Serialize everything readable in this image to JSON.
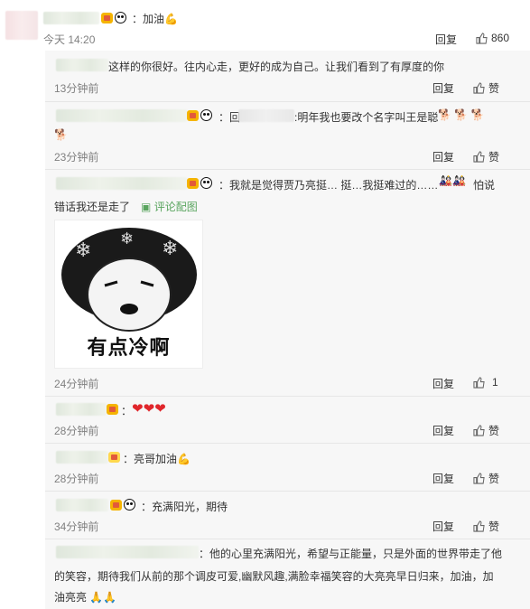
{
  "top_comment": {
    "time": "今天 14:20",
    "text": "：加油",
    "reply_label": "回复",
    "like_count": "860"
  },
  "replies": [
    {
      "text": "这样的你很好。往内心走，更好的成为自己。让我们看到了有厚度的你",
      "time": "13分钟前",
      "reply_label": "回复",
      "like_label": "赞"
    },
    {
      "prefix": "：回",
      "text": ":明年我也要改个名字叫王是聪",
      "time": "23分钟前",
      "reply_label": "回复",
      "like_label": "赞"
    },
    {
      "text_line1": "：我就是觉得贾乃亮挺… 挺…我挺难过的……",
      "text_line1_tail": "怕说",
      "text_line2": "错话我还是走了",
      "view_image": "评论配图",
      "sticker_caption": "有点冷啊",
      "time": "24分钟前",
      "reply_label": "回复",
      "like_count": "1"
    },
    {
      "text": "：",
      "time": "28分钟前",
      "reply_label": "回复",
      "like_label": "赞"
    },
    {
      "text": "：亮哥加油",
      "time": "28分钟前",
      "reply_label": "回复",
      "like_label": "赞"
    },
    {
      "text": "：充满阳光，期待",
      "time": "34分钟前",
      "reply_label": "回复",
      "like_label": "赞"
    },
    {
      "text_line1": "：他的心里充满阳光，希望与正能量，只是外面的世界带走了他",
      "text_line2": "的笑容，期待我们从前的那个调皮可爱,幽默风趣,满脸幸福笑容的大亮亮早日归来，加油，加",
      "text_line3": "油亮亮"
    }
  ],
  "colors": {
    "accent": "#eb7350",
    "heart": "#e0262b",
    "link_green": "#5aa55f"
  },
  "icons": [
    "crown-icon",
    "panda-icon",
    "like-thumb-icon",
    "image-icon",
    "heart-icon"
  ]
}
